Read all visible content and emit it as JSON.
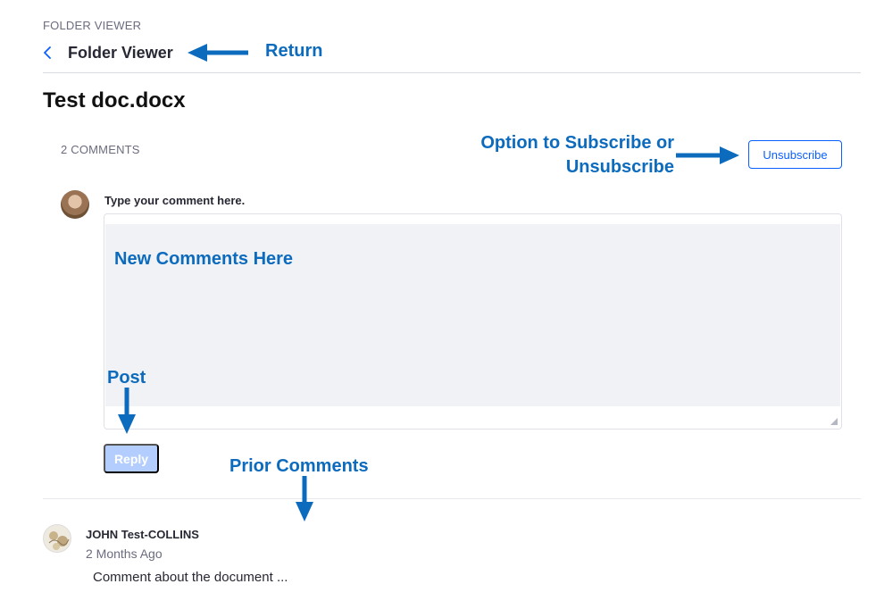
{
  "header": {
    "eyebrow": "FOLDER VIEWER",
    "back_title": "Folder Viewer"
  },
  "document": {
    "title": "Test doc.docx",
    "comment_count": "2 COMMENTS"
  },
  "subscribe": {
    "button_label": "Unsubscribe"
  },
  "editor": {
    "label": "Type your comment here.",
    "reply_label": "Reply"
  },
  "comments": [
    {
      "author": "JOHN Test-COLLINS",
      "time": "2 Months Ago",
      "body": "Comment about the document ..."
    }
  ],
  "annotations": {
    "return": "Return",
    "subscribe_line1": "Option to Subscribe or",
    "subscribe_line2": "Unsubscribe",
    "new_comments": "New Comments Here",
    "post": "Post",
    "prior_comments": "Prior Comments"
  },
  "colors": {
    "accent": "#0b5fff",
    "annotation": "#0c6bbd",
    "reply_disabled": "#b3cdff"
  }
}
